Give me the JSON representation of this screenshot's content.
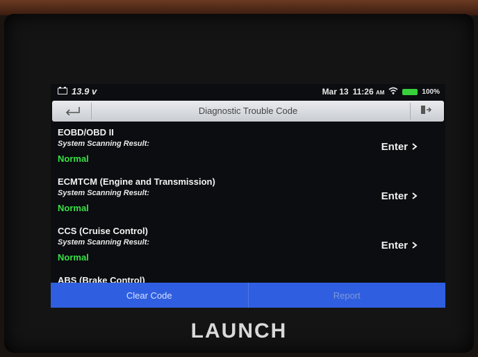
{
  "device": {
    "brand": "LAUNCH"
  },
  "statusbar": {
    "voltage": "13.9",
    "voltage_unit": "v",
    "date": "Mar 13",
    "time": "11:26",
    "ampm": "AM",
    "battery": "100%"
  },
  "titlebar": {
    "title": "Diagnostic Trouble Code"
  },
  "systems": [
    {
      "name": "EOBD/OBD II",
      "sub": "System Scanning Result:",
      "status": "Normal",
      "action": "Enter"
    },
    {
      "name": "ECMTCM (Engine and Transmission)",
      "sub": "System Scanning Result:",
      "status": "Normal",
      "action": "Enter"
    },
    {
      "name": "CCS (Cruise Control)",
      "sub": "System Scanning Result:",
      "status": "Normal",
      "action": "Enter"
    },
    {
      "name": "ABS (Brake Control)"
    }
  ],
  "bottom": {
    "clear_label": "Clear Code",
    "report_label": "Report"
  },
  "colors": {
    "status_ok": "#39e045",
    "bottom_bar": "#2f5fe0"
  }
}
